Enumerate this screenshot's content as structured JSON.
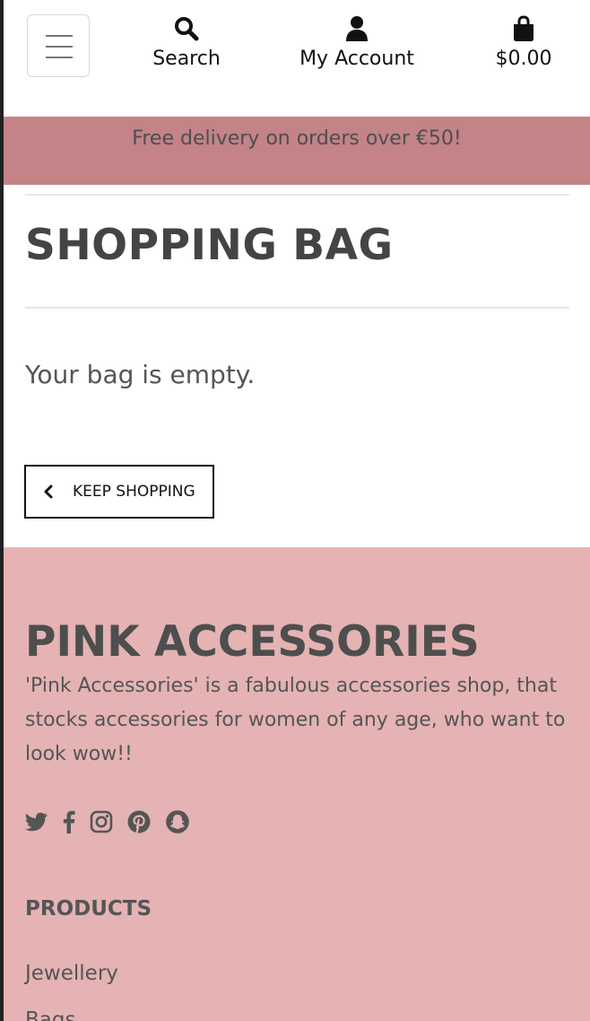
{
  "header": {
    "menu_icon": "hamburger-icon",
    "search": {
      "label": "Search",
      "icon": "search-icon"
    },
    "account": {
      "label": "My Account",
      "icon": "user-icon"
    },
    "bag": {
      "total": "$0.00",
      "icon": "shopping-bag-icon"
    }
  },
  "banner": {
    "text": "Free delivery on orders over €50!"
  },
  "main": {
    "title": "SHOPPING BAG",
    "empty_message": "Your bag is empty.",
    "keep_shopping_label": "KEEP SHOPPING"
  },
  "footer": {
    "title": "PINK ACCESSORIES",
    "description": "'Pink Accessories' is a fabulous accessories shop, that stocks accessories for women of any age, who want to look wow!!",
    "socials": [
      "twitter-icon",
      "facebook-icon",
      "instagram-icon",
      "pinterest-icon",
      "snapchat-icon"
    ],
    "products_heading": "PRODUCTS",
    "product_links": [
      "Jewellery",
      "Bags"
    ]
  },
  "colors": {
    "banner_bg": "#c38387",
    "footer_bg": "#e5b3b3",
    "text": "#555555"
  }
}
